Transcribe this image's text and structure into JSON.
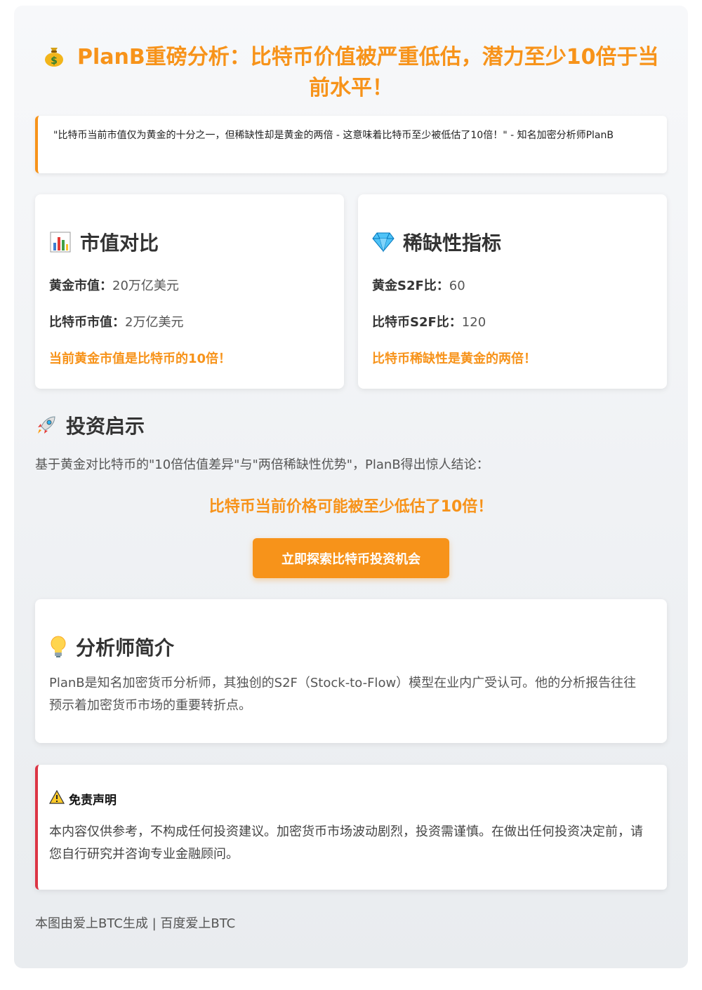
{
  "header": {
    "title": "PlanB重磅分析：比特币价值被严重低估，潜力至少10倍于当前水平！",
    "icon": "money-bag-icon"
  },
  "quote": {
    "text": "\"比特币当前市值仅为黄金的十分之一，但稀缺性却是黄金的两倍 - 这意味着比特币至少被低估了10倍！\" - 知名加密分析师PlanB"
  },
  "market_cap": {
    "title": "市值对比",
    "icon": "bar-chart-icon",
    "gold_label": "黄金市值：",
    "gold_value": "20万亿美元",
    "btc_label": "比特币市值：",
    "btc_value": "2万亿美元",
    "highlight": "当前黄金市值是比特币的10倍！"
  },
  "scarcity": {
    "title": "稀缺性指标",
    "icon": "gem-icon",
    "gold_label": "黄金S2F比：",
    "gold_value": "60",
    "btc_label": "比特币S2F比：",
    "btc_value": "120",
    "highlight": "比特币稀缺性是黄金的两倍！"
  },
  "insight": {
    "title": "投资启示",
    "icon": "rocket-icon",
    "text": "基于黄金对比特币的\"10倍估值差异\"与\"两倍稀缺性优势\"，PlanB得出惊人结论：",
    "conclusion": "比特币当前价格可能被至少低估了10倍！",
    "cta_label": "立即探索比特币投资机会"
  },
  "about": {
    "title": "分析师简介",
    "icon": "light-bulb-icon",
    "text": "PlanB是知名加密货币分析师，其独创的S2F（Stock-to-Flow）模型在业内广受认可。他的分析报告往往预示着加密货币市场的重要转折点。"
  },
  "disclaimer": {
    "title": "免责声明",
    "icon": "warning-icon",
    "text": "本内容仅供参考，不构成任何投资建议。加密货币市场波动剧烈，投资需谨慎。在做出任何投资决定前，请您自行研究并咨询专业金融顾问。"
  },
  "footer": {
    "text": "本图由爱上BTC生成 | 百度爱上BTC"
  },
  "colors": {
    "accent": "#f7931a",
    "danger": "#dc3545"
  }
}
